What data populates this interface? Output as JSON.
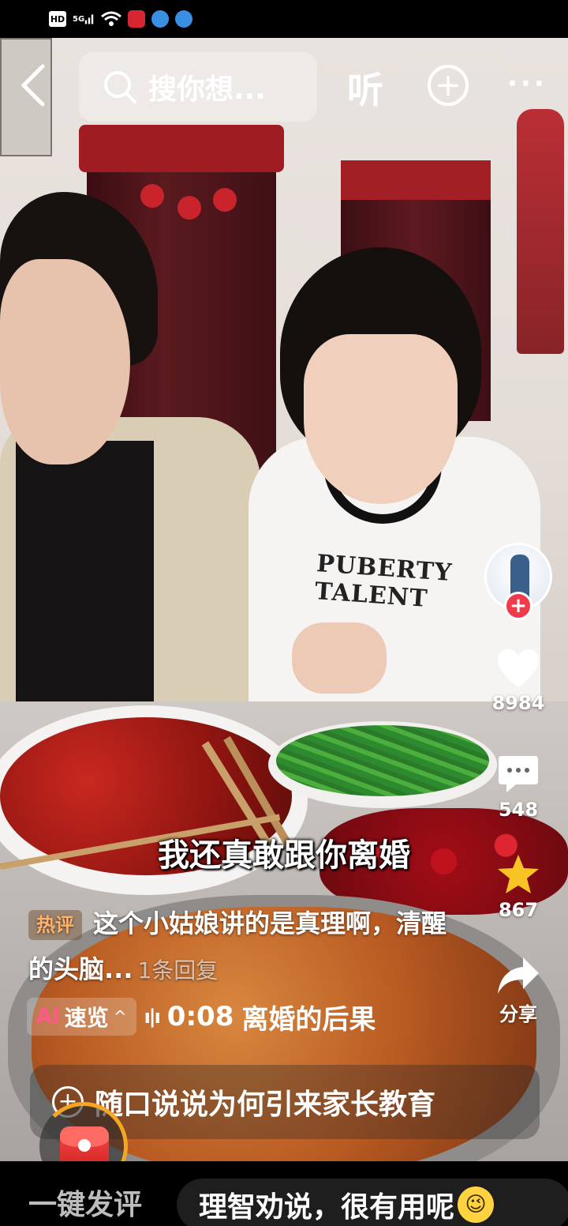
{
  "status_bar": {
    "hd": "HD",
    "network": "5G"
  },
  "nav": {
    "search_placeholder": "搜你想...",
    "listen_label": "听",
    "more_label": "···"
  },
  "actions": {
    "likes": "8984",
    "comments": "548",
    "favorites": "867",
    "share_label": "分享"
  },
  "video": {
    "subtitle": "我还真敢跟你离婚",
    "shirt_print": "PUBERTY TALENT"
  },
  "hot_comment": {
    "tag": "热评",
    "text": "这个小姑娘讲的是真理啊，清醒的头脑...",
    "reply_count": "1条回复"
  },
  "ai_summary": {
    "logo": "AI",
    "label": "速览",
    "time": "0:08",
    "topic": "离婚的后果"
  },
  "prompt_bar": {
    "text": "随口说说为何引来家长教育"
  },
  "bottom": {
    "one_click_label": "一键发评",
    "quick_reply": "理智劝说，很有用呢"
  },
  "colors": {
    "follow_red": "#f23b4a",
    "star_yellow": "#f7c325",
    "hot_tag_orange": "#ffb26b"
  }
}
